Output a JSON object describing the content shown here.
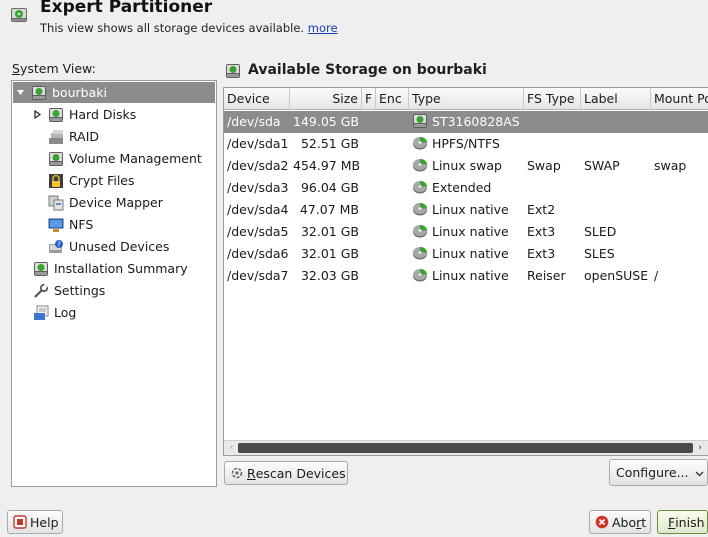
{
  "header": {
    "title": "Expert Partitioner",
    "subtitle": "This view shows all storage devices available.",
    "more_link": "more",
    "icon": "disk-green-icon"
  },
  "system_view": {
    "label_mnemonic": "S",
    "label_rest": "ystem View:",
    "items": [
      {
        "label": "bourbaki",
        "icon": "harddisk-icon",
        "expanded": true,
        "selected": true
      },
      {
        "label": "Hard Disks",
        "icon": "harddisk-icon",
        "expandable": true
      },
      {
        "label": "RAID",
        "icon": "raid-icon"
      },
      {
        "label": "Volume Management",
        "icon": "harddisk-icon"
      },
      {
        "label": "Crypt Files",
        "icon": "lock-icon"
      },
      {
        "label": "Device Mapper",
        "icon": "device-mapper-icon"
      },
      {
        "label": "NFS",
        "icon": "nfs-icon"
      },
      {
        "label": "Unused Devices",
        "icon": "unused-device-icon"
      },
      {
        "label": "Installation Summary",
        "icon": "harddisk-icon"
      },
      {
        "label": "Settings",
        "icon": "wrench-icon"
      },
      {
        "label": "Log",
        "icon": "log-icon"
      }
    ]
  },
  "storage": {
    "title": "Available Storage on bourbaki",
    "columns": [
      "Device",
      "Size",
      "F",
      "Enc",
      "Type",
      "FS Type",
      "Label",
      "Mount Point"
    ],
    "rows": [
      {
        "device": "/dev/sda",
        "size": "149.05 GB",
        "f": "",
        "enc": "",
        "type": "ST3160828AS",
        "fs_type": "",
        "label": "",
        "mount": "",
        "icon": "harddisk-icon",
        "selected": true
      },
      {
        "device": "/dev/sda1",
        "size": "52.51 GB",
        "f": "",
        "enc": "",
        "type": "HPFS/NTFS",
        "fs_type": "",
        "label": "",
        "mount": "",
        "icon": "partition-icon"
      },
      {
        "device": "/dev/sda2",
        "size": "454.97 MB",
        "f": "",
        "enc": "",
        "type": "Linux swap",
        "fs_type": "Swap",
        "label": "SWAP",
        "mount": "swap",
        "icon": "partition-icon"
      },
      {
        "device": "/dev/sda3",
        "size": "96.04 GB",
        "f": "",
        "enc": "",
        "type": "Extended",
        "fs_type": "",
        "label": "",
        "mount": "",
        "icon": "partition-icon"
      },
      {
        "device": "/dev/sda4",
        "size": "47.07 MB",
        "f": "",
        "enc": "",
        "type": "Linux native",
        "fs_type": "Ext2",
        "label": "",
        "mount": "",
        "icon": "partition-icon"
      },
      {
        "device": "/dev/sda5",
        "size": "32.01 GB",
        "f": "",
        "enc": "",
        "type": "Linux native",
        "fs_type": "Ext3",
        "label": "SLED",
        "mount": "",
        "icon": "partition-icon"
      },
      {
        "device": "/dev/sda6",
        "size": "32.01 GB",
        "f": "",
        "enc": "",
        "type": "Linux native",
        "fs_type": "Ext3",
        "label": "SLES",
        "mount": "",
        "icon": "partition-icon"
      },
      {
        "device": "/dev/sda7",
        "size": "32.03 GB",
        "f": "",
        "enc": "",
        "type": "Linux native",
        "fs_type": "Reiser",
        "label": "openSUSE",
        "mount": "/",
        "icon": "partition-icon"
      }
    ]
  },
  "buttons": {
    "rescan_mnemonic_pre": "",
    "rescan_mnemonic": "R",
    "rescan_rest": "escan Devices",
    "configure": "Configure...",
    "help": "Help",
    "abort_pre": "Abo",
    "abort_mnemonic": "r",
    "abort_post": "t",
    "finish_mnemonic": "F",
    "finish_rest": "inish"
  },
  "colors": {
    "selection": "#8c8c8c",
    "link": "#1a3fb8",
    "disk_green": "#3aa22f"
  }
}
